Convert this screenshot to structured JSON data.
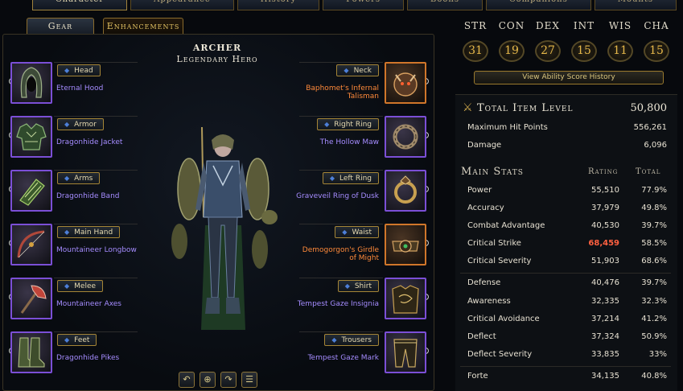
{
  "top_tabs": [
    "Character",
    "Appearance",
    "History",
    "Powers",
    "Boons",
    "Companions",
    "Mounts"
  ],
  "sub_tabs": {
    "gear": "Gear",
    "enhancements": "Enhancements"
  },
  "character": {
    "name": "ARCHER",
    "title": "Legendary Hero"
  },
  "left_slots": [
    {
      "slot": "Head",
      "item": "Eternal Hood",
      "icon": "hood-icon"
    },
    {
      "slot": "Armor",
      "item": "Dragonhide Jacket",
      "icon": "armor-icon"
    },
    {
      "slot": "Arms",
      "item": "Dragonhide Band",
      "icon": "bracer-icon"
    },
    {
      "slot": "Main Hand",
      "item": "Mountaineer Longbow",
      "icon": "bow-icon"
    },
    {
      "slot": "Melee",
      "item": "Mountaineer Axes",
      "icon": "axe-icon"
    },
    {
      "slot": "Feet",
      "item": "Dragonhide Pikes",
      "icon": "boots-icon"
    }
  ],
  "right_slots": [
    {
      "slot": "Neck",
      "item_line1": "Baphomet's Infernal",
      "item_line2": "Talisman",
      "rarity": "orange",
      "icon": "talisman-icon"
    },
    {
      "slot": "Right Ring",
      "item_line1": "The Hollow Maw",
      "item_line2": "",
      "rarity": "purple",
      "icon": "ring-icon"
    },
    {
      "slot": "Left Ring",
      "item_line1": "Graveveil Ring of Dusk",
      "item_line2": "",
      "rarity": "purple",
      "icon": "ring-icon"
    },
    {
      "slot": "Waist",
      "item_line1": "Demogorgon's Girdle",
      "item_line2": "of Might",
      "rarity": "orange",
      "icon": "girdle-icon"
    },
    {
      "slot": "Shirt",
      "item_line1": "Tempest Gaze Insignia",
      "item_line2": "",
      "rarity": "purple",
      "icon": "shirt-icon"
    },
    {
      "slot": "Trousers",
      "item_line1": "Tempest Gaze Mark",
      "item_line2": "",
      "rarity": "purple",
      "icon": "trousers-icon"
    }
  ],
  "controls": [
    "rotate-left-icon",
    "zoom-icon",
    "rotate-right-icon",
    "options-icon"
  ],
  "abilities": [
    {
      "name": "STR",
      "value": "31"
    },
    {
      "name": "CON",
      "value": "19"
    },
    {
      "name": "DEX",
      "value": "27"
    },
    {
      "name": "INT",
      "value": "15"
    },
    {
      "name": "WIS",
      "value": "11"
    },
    {
      "name": "CHA",
      "value": "15"
    }
  ],
  "history_button": "View Ability Score History",
  "total_item_level": {
    "label": "Total Item Level",
    "value": "50,800"
  },
  "summary": [
    {
      "label": "Maximum Hit Points",
      "value": "556,261"
    },
    {
      "label": "Damage",
      "value": "6,096"
    }
  ],
  "main_stats_title": "Main Stats",
  "columns": {
    "rating": "Rating",
    "total": "Total"
  },
  "stats_group1": [
    {
      "label": "Power",
      "rating": "55,510",
      "total": "77.9%",
      "highlight": false
    },
    {
      "label": "Accuracy",
      "rating": "37,979",
      "total": "49.8%",
      "highlight": false
    },
    {
      "label": "Combat Advantage",
      "rating": "40,530",
      "total": "39.7%",
      "highlight": false
    },
    {
      "label": "Critical Strike",
      "rating": "68,459",
      "total": "58.5%",
      "highlight": true
    },
    {
      "label": "Critical Severity",
      "rating": "51,903",
      "total": "68.6%",
      "highlight": false
    }
  ],
  "stats_group2": [
    {
      "label": "Defense",
      "rating": "40,476",
      "total": "39.7%",
      "highlight": false
    },
    {
      "label": "Awareness",
      "rating": "32,335",
      "total": "32.3%",
      "highlight": false
    },
    {
      "label": "Critical Avoidance",
      "rating": "37,214",
      "total": "41.2%",
      "highlight": false
    },
    {
      "label": "Deflect",
      "rating": "37,324",
      "total": "50.9%",
      "highlight": false
    },
    {
      "label": "Deflect Severity",
      "rating": "33,835",
      "total": "33%",
      "highlight": false
    }
  ],
  "stats_group3": [
    {
      "label": "Forte",
      "rating": "34,135",
      "total": "40.8%",
      "highlight": false
    }
  ],
  "colors": {
    "purple_rarity": "#7b4fd6",
    "orange_rarity": "#d0762a",
    "highlight_stat": "#ff6040",
    "gold": "#e6b84a"
  }
}
